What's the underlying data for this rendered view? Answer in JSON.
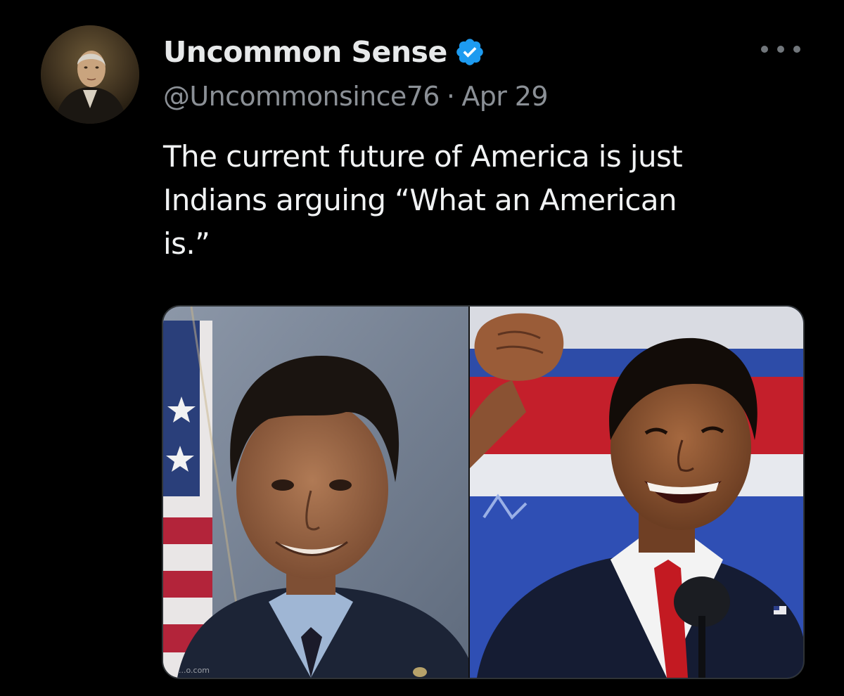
{
  "tweet": {
    "author": {
      "display_name": "Uncommon Sense",
      "handle": "@Uncommonsince76",
      "verified": true,
      "verified_icon": "verified-badge-icon",
      "verified_color": "#1d9bf0"
    },
    "separator": "·",
    "date": "Apr 29",
    "more_icon": "more-options-icon",
    "text_lines": [
      "The current future of America is just",
      "Indians arguing “What an American",
      "is.”"
    ],
    "media": {
      "left_watermark": "...o.com"
    }
  },
  "colors": {
    "background": "#000000",
    "text_primary": "#e7e9ea",
    "text_secondary": "#71767b",
    "accent": "#1d9bf0"
  }
}
